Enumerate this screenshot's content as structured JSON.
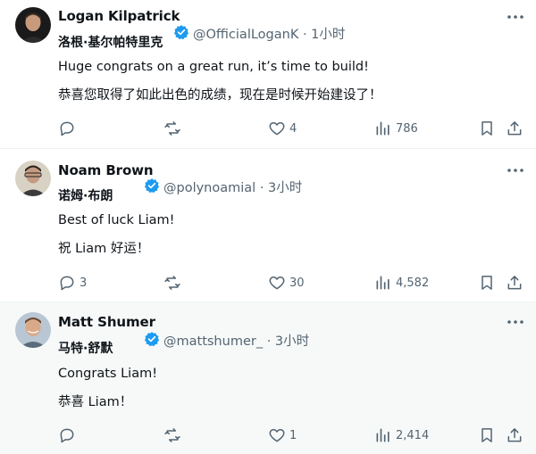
{
  "tweets": [
    {
      "author": "Logan Kilpatrick",
      "display_name_cn": "洛根·基尔帕特里克",
      "handle": "@OfficialLoganK",
      "separator": "·",
      "time": "1小时",
      "lines": [
        "Huge congrats on a great run, it’s time to build!",
        "恭喜您取得了如此出色的成绩，现在是时候开始建设了！"
      ],
      "replies": "",
      "retweets": "",
      "likes": "4",
      "views": "786",
      "highlighted": false
    },
    {
      "author": "Noam Brown",
      "display_name_cn": "诺姆·布朗",
      "handle": "@polynoamial",
      "separator": "·",
      "time": "3小时",
      "lines": [
        "Best of luck Liam!",
        "祝 Liam 好运！"
      ],
      "replies": "3",
      "retweets": "",
      "likes": "30",
      "views": "4,582",
      "highlighted": false
    },
    {
      "author": "Matt Shumer",
      "display_name_cn": "马特·舒默",
      "handle": "@mattshumer_",
      "separator": "·",
      "time": "3小时",
      "lines": [
        "Congrats Liam!",
        "恭喜 Liam！"
      ],
      "replies": "",
      "retweets": "",
      "likes": "1",
      "views": "2,414",
      "highlighted": true
    }
  ],
  "colors": {
    "verified": "#1d9bf0",
    "icon": "#536471",
    "highlight_bg": "#f7f9f9",
    "divider": "#eff3f4"
  },
  "icons": {
    "reply": "reply-icon",
    "retweet": "retweet-icon",
    "like": "heart-icon",
    "views": "views-icon",
    "bookmark": "bookmark-icon",
    "share": "share-icon",
    "more": "more-icon",
    "verified": "verified-badge-icon"
  }
}
